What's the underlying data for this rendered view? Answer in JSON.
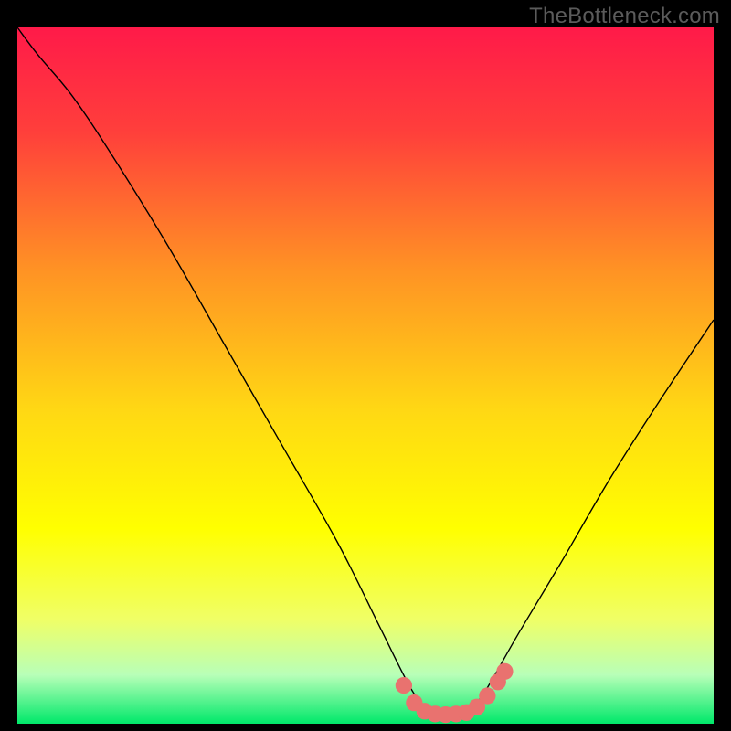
{
  "watermark": "TheBottleneck.com",
  "chart_data": {
    "type": "line",
    "title": "",
    "xlabel": "",
    "ylabel": "",
    "xlim": [
      0,
      100
    ],
    "ylim": [
      0,
      100
    ],
    "gradient_stops": [
      {
        "offset": 0.0,
        "color": "#ff1a49"
      },
      {
        "offset": 0.15,
        "color": "#ff3f3b"
      },
      {
        "offset": 0.35,
        "color": "#ff9324"
      },
      {
        "offset": 0.55,
        "color": "#ffd814"
      },
      {
        "offset": 0.72,
        "color": "#ffff00"
      },
      {
        "offset": 0.85,
        "color": "#f0ff66"
      },
      {
        "offset": 0.93,
        "color": "#b8ffb8"
      },
      {
        "offset": 1.0,
        "color": "#00e86a"
      }
    ],
    "series": [
      {
        "name": "bottleneck-curve",
        "x": [
          0,
          3,
          8,
          14,
          22,
          30,
          38,
          46,
          52,
          56,
          58,
          60,
          62,
          64,
          66,
          68,
          72,
          78,
          85,
          92,
          100
        ],
        "y": [
          100,
          96,
          90,
          81,
          68,
          54,
          40,
          26,
          14,
          6,
          3,
          1.5,
          1.2,
          1.5,
          3,
          6,
          13,
          23,
          35,
          46,
          58
        ]
      }
    ],
    "markers": {
      "name": "trough-markers",
      "color": "#e9726f",
      "radius": 1.2,
      "points": [
        {
          "x": 55.5,
          "y": 5.5
        },
        {
          "x": 57.0,
          "y": 3.0
        },
        {
          "x": 58.5,
          "y": 1.8
        },
        {
          "x": 60.0,
          "y": 1.4
        },
        {
          "x": 61.5,
          "y": 1.3
        },
        {
          "x": 63.0,
          "y": 1.4
        },
        {
          "x": 64.5,
          "y": 1.6
        },
        {
          "x": 66.0,
          "y": 2.4
        },
        {
          "x": 67.5,
          "y": 4.0
        },
        {
          "x": 69.0,
          "y": 6.0
        },
        {
          "x": 70.0,
          "y": 7.5
        }
      ]
    }
  }
}
